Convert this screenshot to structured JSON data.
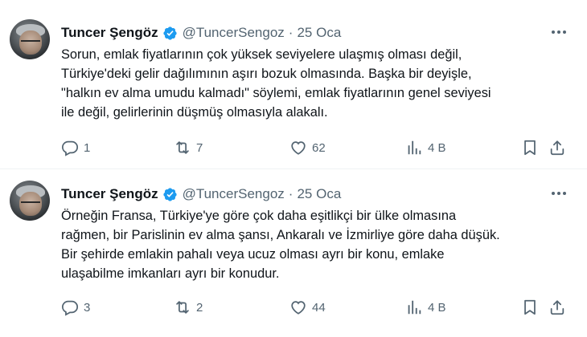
{
  "colors": {
    "text": "#0f1419",
    "muted": "#536471",
    "verified": "#1d9bf0",
    "divider": "#eff3f4"
  },
  "tweets": [
    {
      "name": "Tuncer Şengöz",
      "handle": "@TuncerSengoz",
      "separator": "·",
      "date": "25 Oca",
      "lines": [
        "Sorun, emlak fiyatlarının çok yüksek seviyelere ulaşmış olması değil,",
        "Türkiye'deki gelir dağılımının aşırı bozuk olmasında. Başka bir deyişle,",
        "\"halkın ev alma umudu kalmadı\" söylemi, emlak fiyatlarının genel seviyesi",
        "ile değil, gelirlerinin düşmüş olmasıyla alakalı."
      ],
      "replies": "1",
      "retweets": "7",
      "likes": "62",
      "views": "4 B"
    },
    {
      "name": "Tuncer Şengöz",
      "handle": "@TuncerSengoz",
      "separator": "·",
      "date": "25 Oca",
      "lines": [
        "Örneğin Fransa, Türkiye'ye göre çok daha eşitlikçi bir ülke olmasına",
        "rağmen, bir Parislinin ev alma şansı, Ankaralı ve İzmirliye göre daha düşük.",
        "Bir şehirde emlakin pahalı veya ucuz olması ayrı bir konu, emlake",
        "ulaşabilme imkanları ayrı bir konudur."
      ],
      "replies": "3",
      "retweets": "2",
      "likes": "44",
      "views": "4 B"
    }
  ],
  "icons": {
    "verified": "verified-badge-icon",
    "more": "more-dots-icon",
    "reply": "reply-icon",
    "retweet": "retweet-icon",
    "like": "heart-icon",
    "views": "views-bar-chart-icon",
    "bookmark": "bookmark-icon",
    "share": "share-icon"
  }
}
